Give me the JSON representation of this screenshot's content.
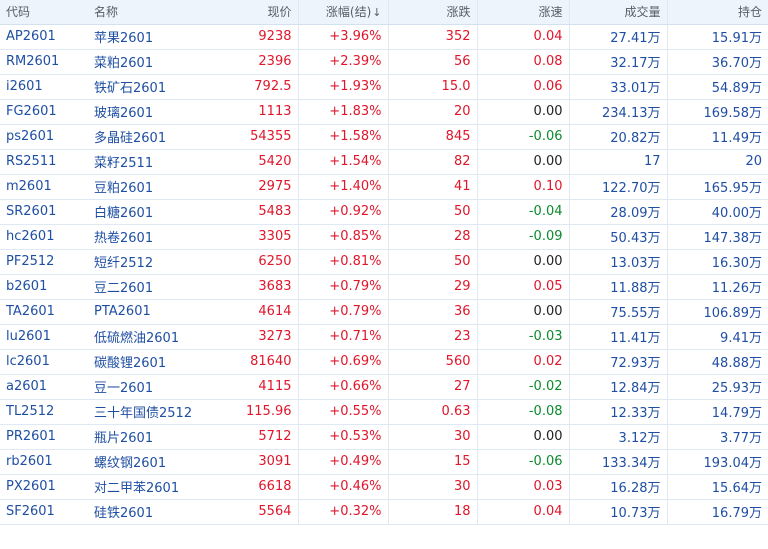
{
  "header": {
    "code": "代码",
    "name": "名称",
    "price": "现价",
    "change_pct": "涨幅(结)",
    "sort_arrow": "↓",
    "change": "涨跌",
    "speed": "涨速",
    "volume": "成交量",
    "open_interest": "持仓"
  },
  "colors": {
    "up": "#e0162b",
    "down": "#0d8a2e",
    "flat": "#222222",
    "link_blue": "#1f4fa3"
  },
  "rows": [
    {
      "code": "AP2601",
      "name": "苹果2601",
      "price": "9238",
      "change_pct": "+3.96%",
      "change": "352",
      "speed": "0.04",
      "speed_dir": "up",
      "volume": "27.41万",
      "oi": "15.91万"
    },
    {
      "code": "RM2601",
      "name": "菜粕2601",
      "price": "2396",
      "change_pct": "+2.39%",
      "change": "56",
      "speed": "0.08",
      "speed_dir": "up",
      "volume": "32.17万",
      "oi": "36.70万"
    },
    {
      "code": "i2601",
      "name": "铁矿石2601",
      "price": "792.5",
      "change_pct": "+1.93%",
      "change": "15.0",
      "speed": "0.06",
      "speed_dir": "up",
      "volume": "33.01万",
      "oi": "54.89万"
    },
    {
      "code": "FG2601",
      "name": "玻璃2601",
      "price": "1113",
      "change_pct": "+1.83%",
      "change": "20",
      "speed": "0.00",
      "speed_dir": "flat",
      "volume": "234.13万",
      "oi": "169.58万"
    },
    {
      "code": "ps2601",
      "name": "多晶硅2601",
      "price": "54355",
      "change_pct": "+1.58%",
      "change": "845",
      "speed": "-0.06",
      "speed_dir": "down",
      "volume": "20.82万",
      "oi": "11.49万"
    },
    {
      "code": "RS2511",
      "name": "菜籽2511",
      "price": "5420",
      "change_pct": "+1.54%",
      "change": "82",
      "speed": "0.00",
      "speed_dir": "flat",
      "volume": "17",
      "oi": "20"
    },
    {
      "code": "m2601",
      "name": "豆粕2601",
      "price": "2975",
      "change_pct": "+1.40%",
      "change": "41",
      "speed": "0.10",
      "speed_dir": "up",
      "volume": "122.70万",
      "oi": "165.95万"
    },
    {
      "code": "SR2601",
      "name": "白糖2601",
      "price": "5483",
      "change_pct": "+0.92%",
      "change": "50",
      "speed": "-0.04",
      "speed_dir": "down",
      "volume": "28.09万",
      "oi": "40.00万"
    },
    {
      "code": "hc2601",
      "name": "热卷2601",
      "price": "3305",
      "change_pct": "+0.85%",
      "change": "28",
      "speed": "-0.09",
      "speed_dir": "down",
      "volume": "50.43万",
      "oi": "147.38万"
    },
    {
      "code": "PF2512",
      "name": "短纤2512",
      "price": "6250",
      "change_pct": "+0.81%",
      "change": "50",
      "speed": "0.00",
      "speed_dir": "flat",
      "volume": "13.03万",
      "oi": "16.30万"
    },
    {
      "code": "b2601",
      "name": "豆二2601",
      "price": "3683",
      "change_pct": "+0.79%",
      "change": "29",
      "speed": "0.05",
      "speed_dir": "up",
      "volume": "11.88万",
      "oi": "11.26万"
    },
    {
      "code": "TA2601",
      "name": "PTA2601",
      "price": "4614",
      "change_pct": "+0.79%",
      "change": "36",
      "speed": "0.00",
      "speed_dir": "flat",
      "volume": "75.55万",
      "oi": "106.89万"
    },
    {
      "code": "lu2601",
      "name": "低硫燃油2601",
      "price": "3273",
      "change_pct": "+0.71%",
      "change": "23",
      "speed": "-0.03",
      "speed_dir": "down",
      "volume": "11.41万",
      "oi": "9.41万"
    },
    {
      "code": "lc2601",
      "name": "碳酸锂2601",
      "price": "81640",
      "change_pct": "+0.69%",
      "change": "560",
      "speed": "0.02",
      "speed_dir": "up",
      "volume": "72.93万",
      "oi": "48.88万"
    },
    {
      "code": "a2601",
      "name": "豆一2601",
      "price": "4115",
      "change_pct": "+0.66%",
      "change": "27",
      "speed": "-0.02",
      "speed_dir": "down",
      "volume": "12.84万",
      "oi": "25.93万"
    },
    {
      "code": "TL2512",
      "name": "三十年国债2512",
      "price": "115.96",
      "change_pct": "+0.55%",
      "change": "0.63",
      "speed": "-0.08",
      "speed_dir": "down",
      "volume": "12.33万",
      "oi": "14.79万"
    },
    {
      "code": "PR2601",
      "name": "瓶片2601",
      "price": "5712",
      "change_pct": "+0.53%",
      "change": "30",
      "speed": "0.00",
      "speed_dir": "flat",
      "volume": "3.12万",
      "oi": "3.77万"
    },
    {
      "code": "rb2601",
      "name": "螺纹钢2601",
      "price": "3091",
      "change_pct": "+0.49%",
      "change": "15",
      "speed": "-0.06",
      "speed_dir": "down",
      "volume": "133.34万",
      "oi": "193.04万"
    },
    {
      "code": "PX2601",
      "name": "对二甲苯2601",
      "price": "6618",
      "change_pct": "+0.46%",
      "change": "30",
      "speed": "0.03",
      "speed_dir": "up",
      "volume": "16.28万",
      "oi": "15.64万"
    },
    {
      "code": "SF2601",
      "name": "硅铁2601",
      "price": "5564",
      "change_pct": "+0.32%",
      "change": "18",
      "speed": "0.04",
      "speed_dir": "up",
      "volume": "10.73万",
      "oi": "16.79万"
    }
  ]
}
